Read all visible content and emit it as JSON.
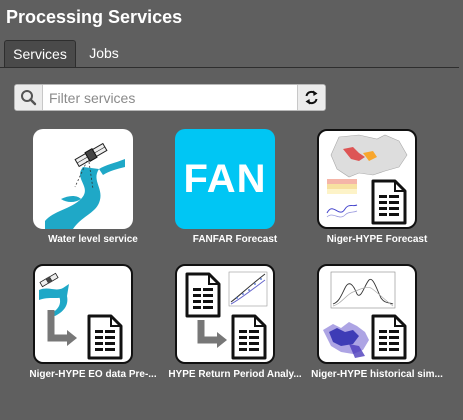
{
  "header": {
    "title": "Processing Services"
  },
  "tabs": [
    {
      "label": "Services",
      "active": true
    },
    {
      "label": "Jobs",
      "active": false
    }
  ],
  "search": {
    "placeholder": "Filter services",
    "value": ""
  },
  "icons": {
    "search": "search-icon",
    "refresh": "refresh-icon"
  },
  "services": [
    {
      "label": "Water level service",
      "icon": "river-satellite-icon"
    },
    {
      "label": "FANFAR Forecast",
      "icon": "fan-logo",
      "logo_text": "FAN"
    },
    {
      "label": "Niger-HYPE Forecast",
      "icon": "map-chart-document-icon"
    },
    {
      "label": "Niger-HYPE EO data Pre-...",
      "icon": "satellite-document-icon"
    },
    {
      "label": "HYPE Return Period Analy...",
      "icon": "document-chart-icon"
    },
    {
      "label": "Niger-HYPE historical sim...",
      "icon": "chart-map-document-icon"
    }
  ],
  "colors": {
    "background": "#5f5f5f",
    "fan_blue": "#00c6f4",
    "river": "#1fa8c7"
  }
}
